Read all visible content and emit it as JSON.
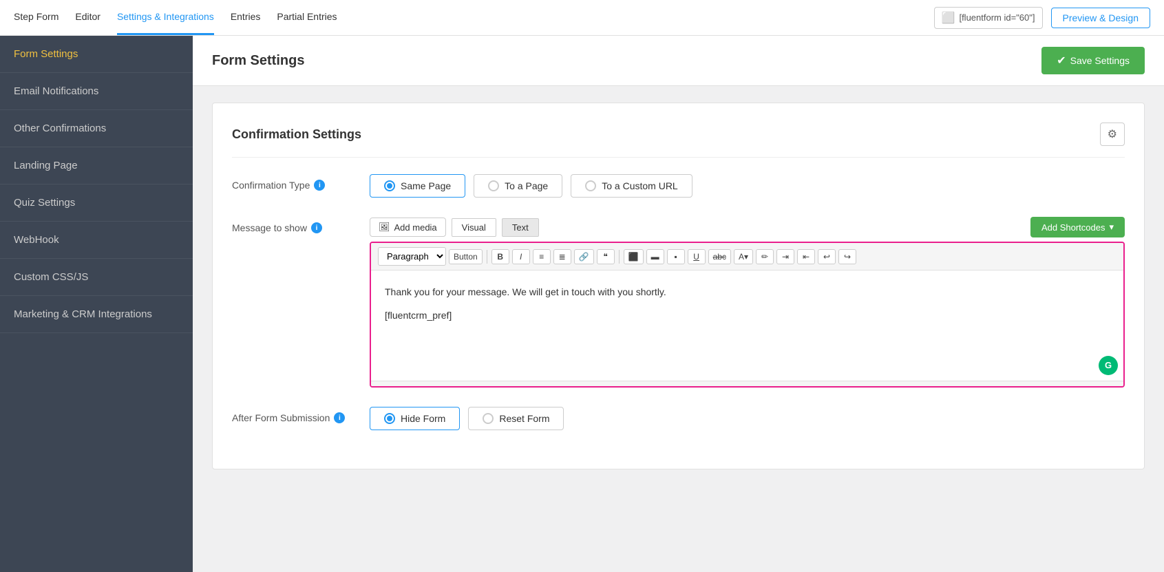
{
  "topNav": {
    "items": [
      {
        "id": "step-form",
        "label": "Step Form",
        "active": false
      },
      {
        "id": "editor",
        "label": "Editor",
        "active": false
      },
      {
        "id": "settings-integrations",
        "label": "Settings & Integrations",
        "active": true
      },
      {
        "id": "entries",
        "label": "Entries",
        "active": false
      },
      {
        "id": "partial-entries",
        "label": "Partial Entries",
        "active": false
      }
    ],
    "shortcode": "[fluentform id=\"60\"]",
    "previewLabel": "Preview & Design"
  },
  "sidebar": {
    "items": [
      {
        "id": "form-settings",
        "label": "Form Settings",
        "active": true
      },
      {
        "id": "email-notifications",
        "label": "Email Notifications",
        "active": false
      },
      {
        "id": "other-confirmations",
        "label": "Other Confirmations",
        "active": false
      },
      {
        "id": "landing-page",
        "label": "Landing Page",
        "active": false
      },
      {
        "id": "quiz-settings",
        "label": "Quiz Settings",
        "active": false
      },
      {
        "id": "webhook",
        "label": "WebHook",
        "active": false
      },
      {
        "id": "custom-css-js",
        "label": "Custom CSS/JS",
        "active": false
      },
      {
        "id": "marketing-crm",
        "label": "Marketing & CRM Integrations",
        "active": false
      }
    ]
  },
  "pageHeader": {
    "title": "Form Settings",
    "saveLabel": "Save Settings"
  },
  "card": {
    "title": "Confirmation Settings",
    "confirmationType": {
      "label": "Confirmation Type",
      "options": [
        {
          "id": "same-page",
          "label": "Same Page",
          "selected": true
        },
        {
          "id": "to-a-page",
          "label": "To a Page",
          "selected": false
        },
        {
          "id": "to-custom-url",
          "label": "To a Custom URL",
          "selected": false
        }
      ]
    },
    "messageToShow": {
      "label": "Message to show",
      "addMediaLabel": "Add media",
      "visualTab": "Visual",
      "textTab": "Text",
      "addShortcodesLabel": "Add Shortcodes",
      "toolbarParagraph": "Paragraph",
      "toolbarButtonLabel": "Button",
      "editorContent": [
        "Thank you for your message. We will get in touch with you shortly.",
        "[fluentcrm_pref]"
      ]
    },
    "afterFormSubmission": {
      "label": "After Form Submission",
      "options": [
        {
          "id": "hide-form",
          "label": "Hide Form",
          "selected": true
        },
        {
          "id": "reset-form",
          "label": "Reset Form",
          "selected": false
        }
      ]
    }
  }
}
